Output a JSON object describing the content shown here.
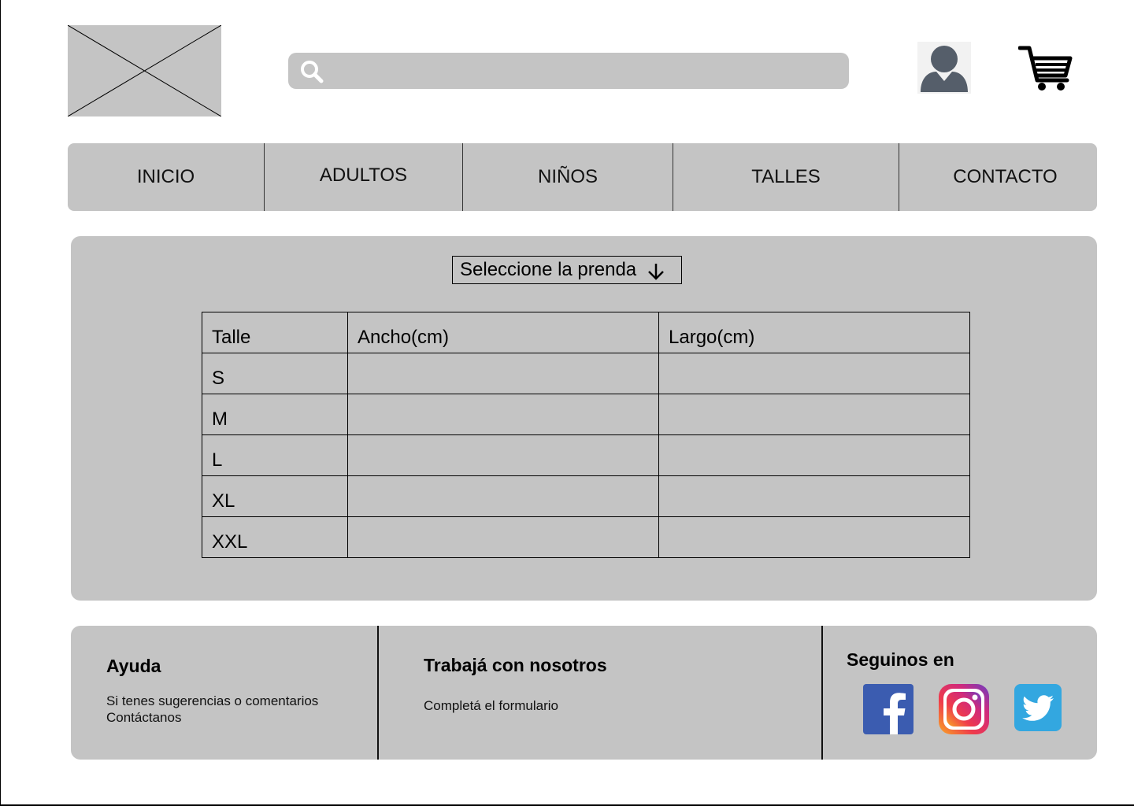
{
  "header": {
    "logo": "image-placeholder",
    "search": {
      "placeholder": "",
      "value": "",
      "icon": "search-icon"
    },
    "user_icon": "user-icon",
    "cart_icon": "cart-icon"
  },
  "nav": {
    "items": [
      {
        "label": "INICIO"
      },
      {
        "label": "ADULTOS"
      },
      {
        "label": "NIÑOS"
      },
      {
        "label": "TALLES"
      },
      {
        "label": "CONTACTO"
      }
    ]
  },
  "size_guide": {
    "select": {
      "label": "Seleccione la prenda",
      "icon": "arrow-down-icon"
    },
    "table": {
      "headers": [
        "Talle",
        "Ancho(cm)",
        "Largo(cm)"
      ],
      "rows": [
        [
          "S",
          "",
          ""
        ],
        [
          "M",
          "",
          ""
        ],
        [
          "L",
          "",
          ""
        ],
        [
          "XL",
          "",
          ""
        ],
        [
          "XXL",
          "",
          ""
        ]
      ]
    }
  },
  "footer": {
    "help": {
      "title": "Ayuda",
      "line1": "Si tenes sugerencias o comentarios",
      "line2": "Contáctanos"
    },
    "work": {
      "title": "Trabajá con nosotros",
      "text": "Completá el formulario"
    },
    "social": {
      "title": "Seguinos en",
      "networks": [
        "facebook-icon",
        "instagram-icon",
        "twitter-icon"
      ]
    }
  },
  "colors": {
    "panel": "#c4c4c4",
    "facebook": "#3b5cb0",
    "twitter": "#33a7e0"
  }
}
